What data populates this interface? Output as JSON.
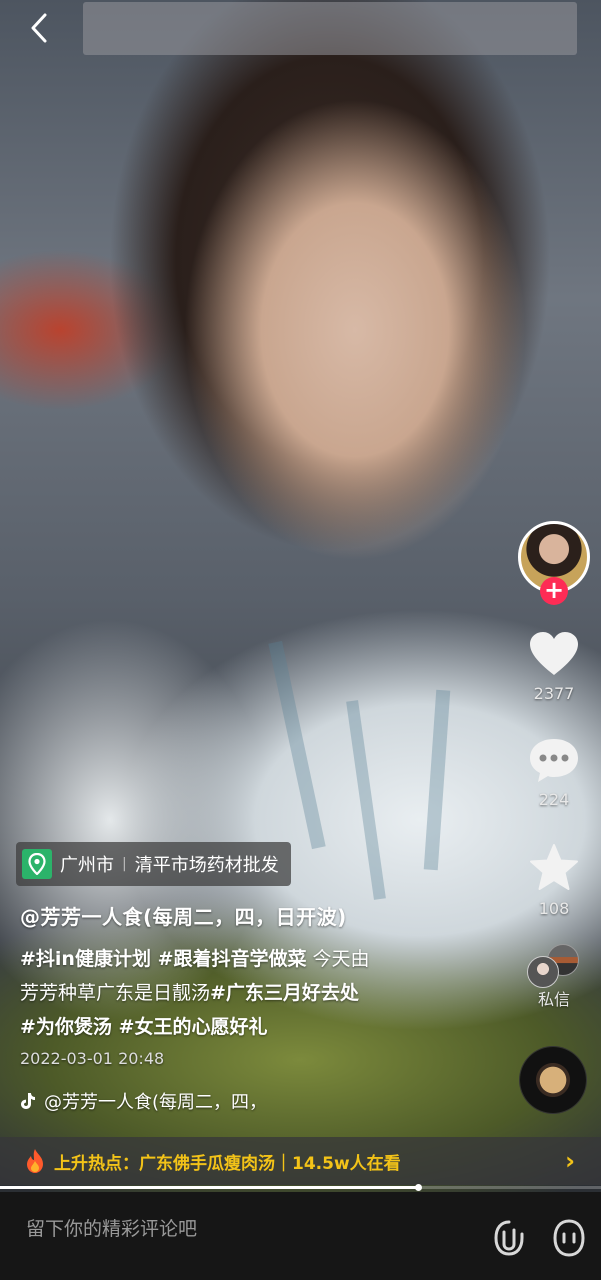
{
  "top": {
    "search_placeholder": ""
  },
  "creator": {
    "follow_symbol": "+"
  },
  "actions": {
    "likes": "2377",
    "comments": "224",
    "favorites": "108",
    "dm_label": "私信"
  },
  "location": {
    "city": "广州市",
    "place": "清平市场药材批发"
  },
  "post": {
    "author": "@芳芳一人食(每周二，四，日开波)",
    "caption_line1_tags": "#抖in健康计划 #跟着抖音学做菜",
    "caption_line1_text": " 今天由",
    "caption_line2_text": "芳芳种草广东是日靓汤",
    "caption_line2_tag": "#广东三月好去处",
    "caption_line3_tags": "#为你煲汤 #女王的心愿好礼",
    "date": "2022-03-01 20:48",
    "music": "@芳芳一人食(每周二，四，"
  },
  "hot": {
    "text": "上升热点：广东佛手瓜瘦肉汤｜14.5w人在看",
    "arrow": "›"
  },
  "playback": {
    "progress": 0.695
  },
  "bottom": {
    "comment_placeholder": "留下你的精彩评论吧"
  },
  "icons": [
    "back-icon",
    "heart-icon",
    "comment-icon",
    "star-icon",
    "location-pin-icon",
    "tiktok-note-icon",
    "flame-icon",
    "at-icon",
    "emoji-icon"
  ],
  "colors": {
    "accent_red": "#fe2c55",
    "hot_yellow": "#f3c318",
    "pin_green": "#2bb36a"
  }
}
